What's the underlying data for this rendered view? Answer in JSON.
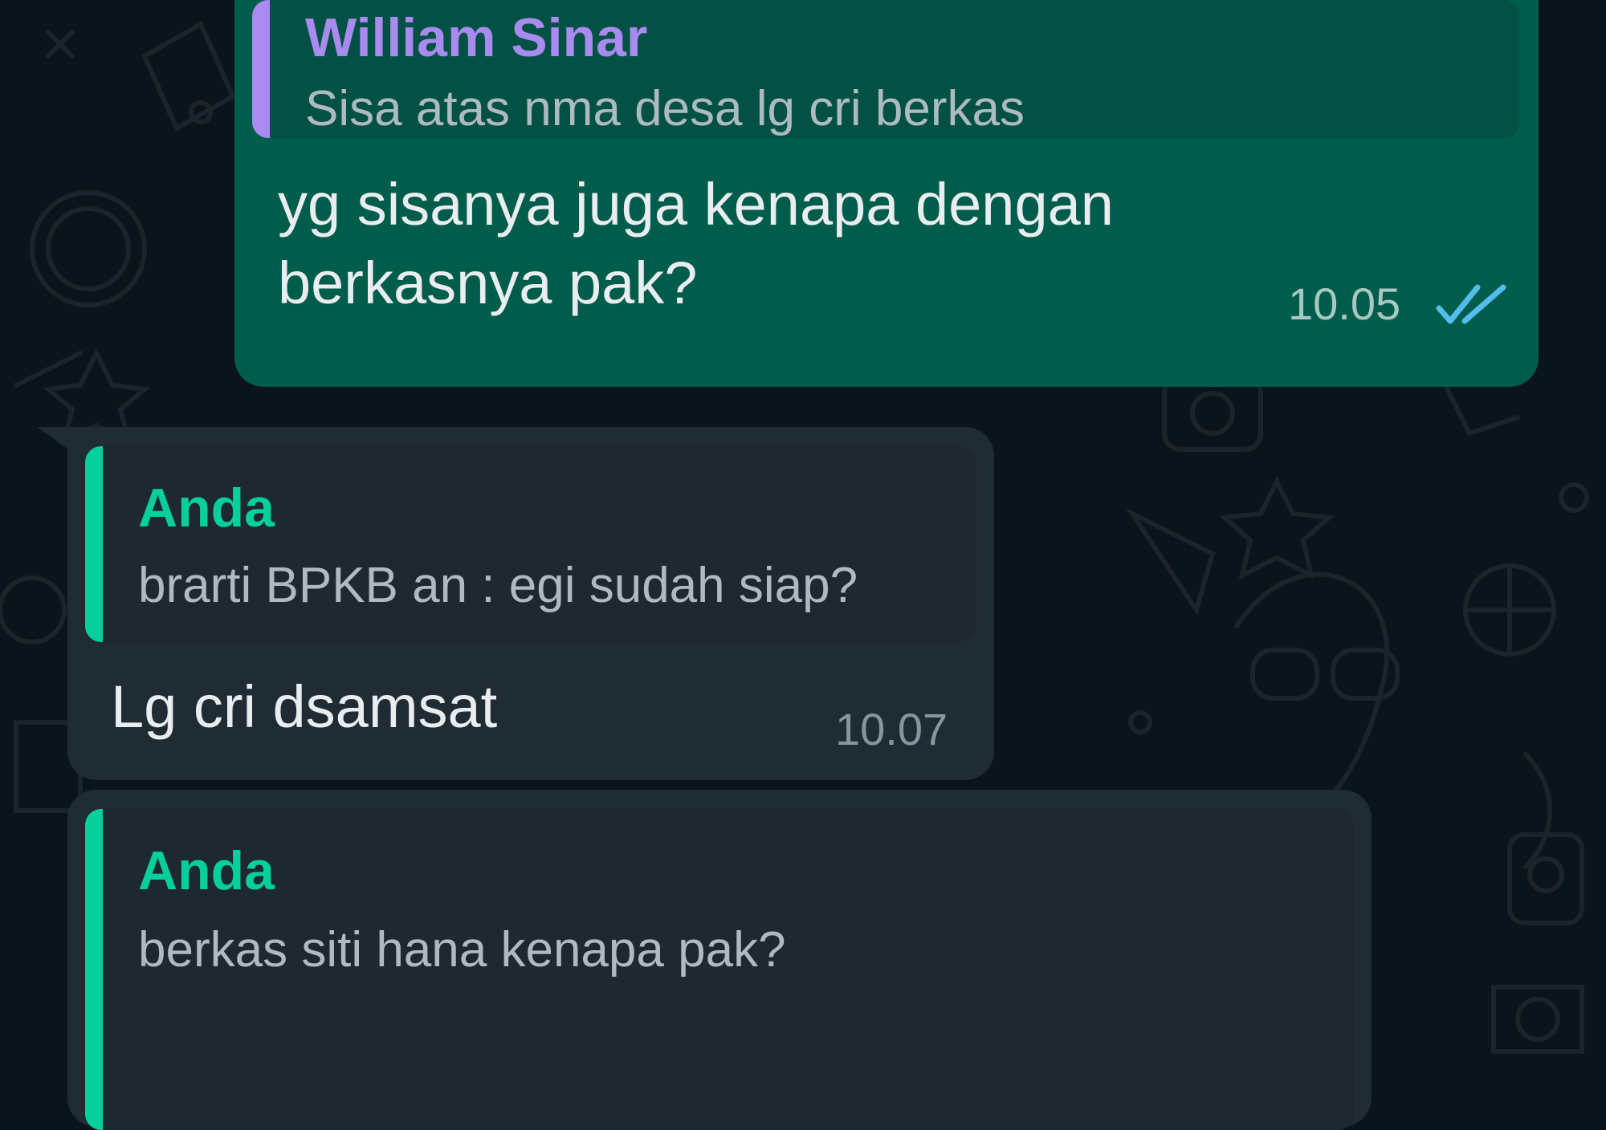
{
  "theme": {
    "background": "#0b141a",
    "outgoing_bubble": "#005c4b",
    "incoming_bubble": "#202c33",
    "quote_bar_purple": "#a98bf0",
    "quote_bar_green": "#06cf9c",
    "read_tick": "#53bdeb"
  },
  "messages": [
    {
      "direction": "outgoing",
      "quote": {
        "author": "William Sinar",
        "text": "Sisa atas nma desa lg cri berkas"
      },
      "text_lines": [
        "yg sisanya juga kenapa dengan",
        "berkasnya pak?"
      ],
      "time": "10.05",
      "status_icon": "double-check-icon"
    },
    {
      "direction": "incoming",
      "quote": {
        "author": "Anda",
        "text": "brarti BPKB an : egi sudah siap?"
      },
      "text_lines": [
        "Lg cri dsamsat"
      ],
      "time": "10.07"
    },
    {
      "direction": "incoming",
      "quote": {
        "author": "Anda",
        "text": "berkas siti hana kenapa pak?"
      },
      "text_lines": [],
      "time": ""
    }
  ]
}
